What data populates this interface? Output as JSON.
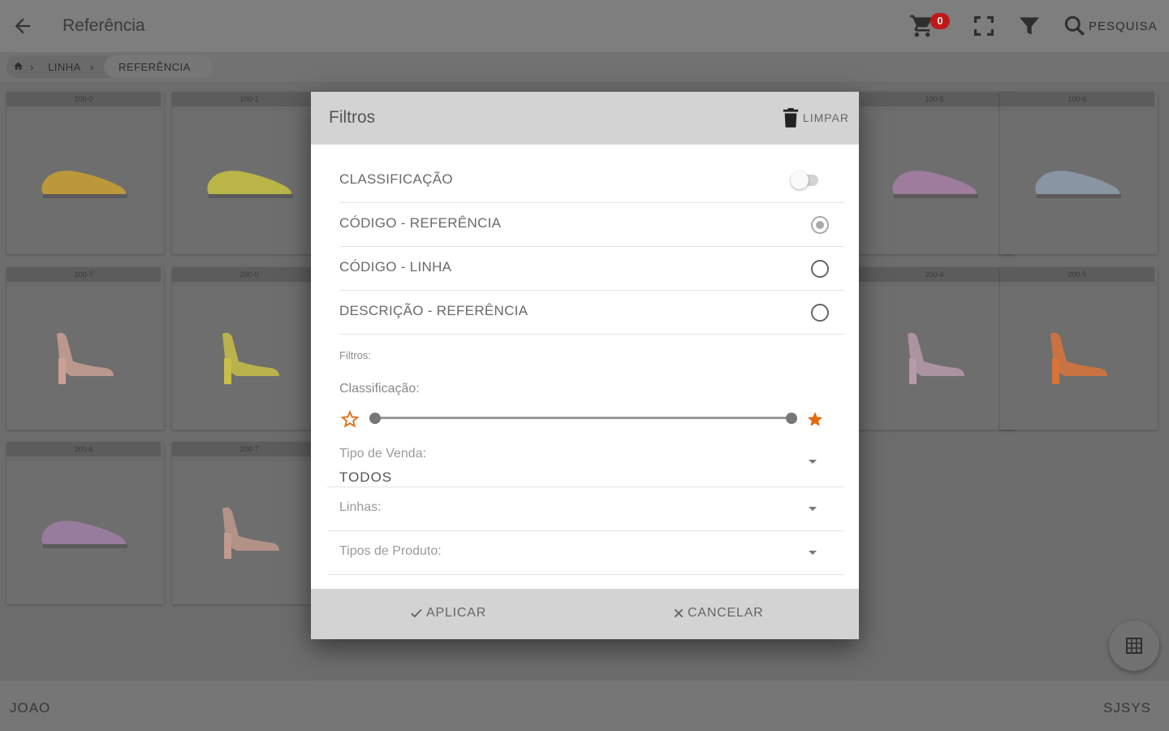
{
  "header": {
    "title": "Referência",
    "cart_count": "0",
    "search_label": "PESQUISA",
    "icons": [
      "back-arrow-icon",
      "cart-icon",
      "fullscreen-icon",
      "filter-icon",
      "search-icon"
    ]
  },
  "breadcrumb": {
    "home_icon": "home-icon",
    "items": [
      "LINHA",
      "REFERÊNCIA"
    ]
  },
  "products": [
    {
      "code": "100-0",
      "color": "#c9a030"
    },
    {
      "code": "100-1",
      "color": "#c8c240"
    },
    {
      "code": "100-5",
      "color": "#a67fa6"
    },
    {
      "code": "100-6",
      "color": "#8e9cad"
    },
    {
      "code": "100-7",
      "color": "#c9a093"
    },
    {
      "code": "200-0",
      "color": "#c8be48"
    },
    {
      "code": "200-4",
      "color": "#b69aab"
    },
    {
      "code": "200-5",
      "color": "#d8743a"
    },
    {
      "code": "200-6",
      "color": "#a07fa6"
    },
    {
      "code": "200-7",
      "color": "#c09a8d"
    }
  ],
  "fab": {
    "icon": "grid-icon"
  },
  "footer": {
    "user": "JOAO",
    "company": "SJSYS"
  },
  "dialog": {
    "title": "Filtros",
    "clear_label": "LIMPAR",
    "sort_options": [
      {
        "label": "CLASSIFICAÇÃO",
        "control": "toggle",
        "on": false
      },
      {
        "label": "CÓDIGO - REFERÊNCIA",
        "control": "radio",
        "selected": true
      },
      {
        "label": "CÓDIGO - LINHA",
        "control": "radio",
        "selected": false
      },
      {
        "label": "DESCRIÇÃO - REFERÊNCIA",
        "control": "radio",
        "selected": false
      }
    ],
    "filters_section": "Filtros:",
    "classification_label": "Classificação:",
    "rating_range": {
      "min": 0,
      "max": 5
    },
    "selects": [
      {
        "label": "Tipo de Venda:",
        "value": "TODOS"
      },
      {
        "label": "Linhas:",
        "value": ""
      },
      {
        "label": "Tipos de Produto:",
        "value": ""
      }
    ],
    "apply_label": "APLICAR",
    "cancel_label": "CANCELAR",
    "accent_color": "#e46a0e"
  }
}
